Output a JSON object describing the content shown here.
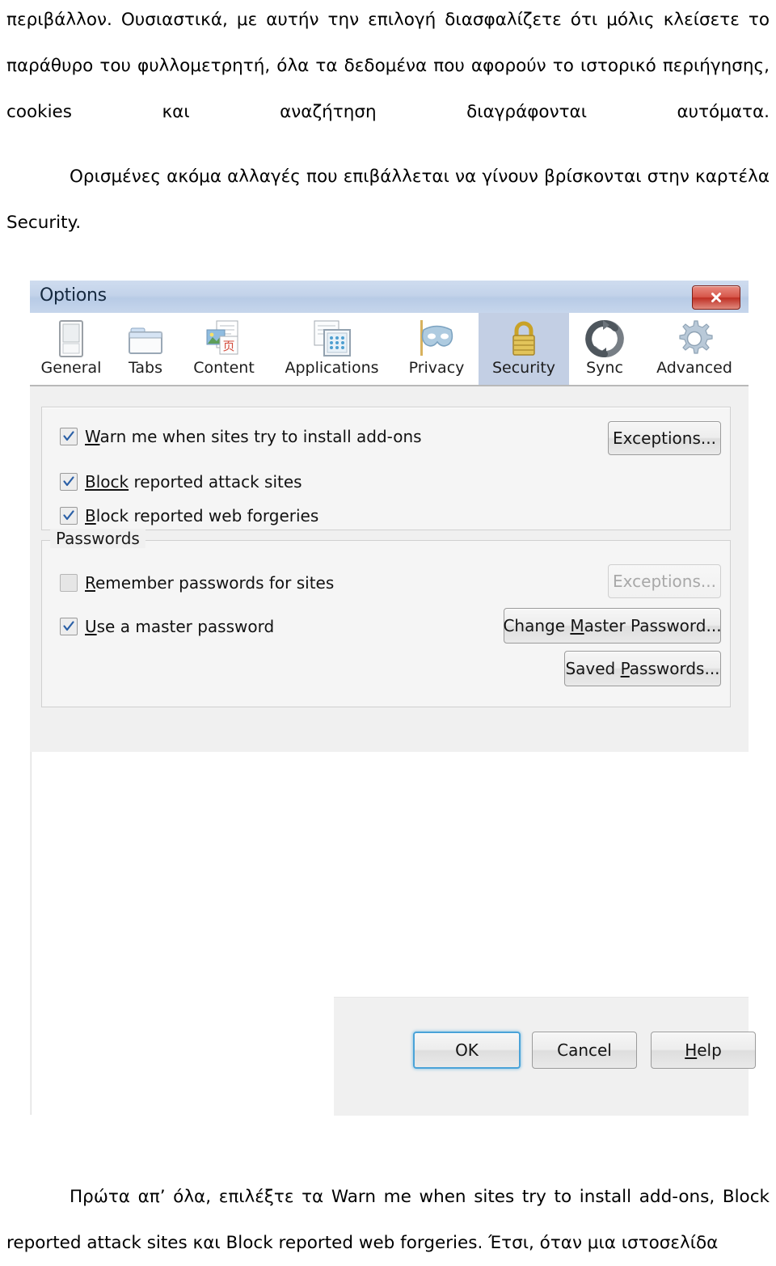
{
  "document": {
    "paragraph_top": "περιβάλλον. Ουσιαστικά, με αυτήν την επιλογή διασφαλίζετε ότι μόλις κλείσετε το παράθυρο του φυλλομετρητή, όλα τα δεδομένα που αφορούν το ιστορικό περιήγησης, cookies και αναζήτηση διαγράφονται αυτόματα.",
    "paragraph_middle": "Ορισμένες ακόμα αλλαγές που επιβάλλεται να γίνουν βρίσκονται στην καρτέλα Security.",
    "paragraph_bottom": "Πρώτα απ’ όλα, επιλέξτε τα Warn me when sites try to install add-ons, Block reported attack sites και Block reported web forgeries. Έτσι, όταν μια ιστοσελίδα"
  },
  "dialog": {
    "title": "Options",
    "close_icon": "close-icon",
    "tabs": [
      {
        "label": "General",
        "icon": "window-icon",
        "selected": false
      },
      {
        "label": "Tabs",
        "icon": "folder-tabs-icon",
        "selected": false
      },
      {
        "label": "Content",
        "icon": "content-page-icon",
        "selected": false
      },
      {
        "label": "Applications",
        "icon": "applications-icon",
        "selected": false
      },
      {
        "label": "Privacy",
        "icon": "mask-icon",
        "selected": false
      },
      {
        "label": "Security",
        "icon": "padlock-icon",
        "selected": true
      },
      {
        "label": "Sync",
        "icon": "sync-arrows-icon",
        "selected": false
      },
      {
        "label": "Advanced",
        "icon": "gear-icon",
        "selected": false
      }
    ],
    "security": {
      "warnings_group": {
        "checkboxes": [
          {
            "label_prefix": "W",
            "label_rest": "arn me when sites try to install add-ons",
            "checked": true
          },
          {
            "label_prefix": "Block",
            "label_rest": " reported attack sites",
            "checked": true
          },
          {
            "label_prefix": "B",
            "label_rest": "lock reported web forgeries",
            "checked": true
          }
        ],
        "exceptions_button": "Exceptions...",
        "exceptions_button_enabled": true
      },
      "passwords_group": {
        "title": "Passwords",
        "checkboxes": [
          {
            "label_prefix": "R",
            "label_rest": "emember passwords for sites",
            "checked": false
          },
          {
            "label_prefix": "U",
            "label_rest": "se a master password",
            "checked": true
          }
        ],
        "exceptions_button": "Exceptions...",
        "exceptions_button_enabled": false,
        "change_master_prefix": "Change ",
        "change_master_key": "M",
        "change_master_rest": "aster Password...",
        "saved_passwords_prefix": "Saved ",
        "saved_passwords_key": "P",
        "saved_passwords_rest": "asswords..."
      }
    },
    "footer": {
      "ok": "OK",
      "cancel": "Cancel",
      "help_key": "H",
      "help_rest": "elp"
    },
    "colors": {
      "titlebar": "#c3d3ea",
      "selected_tab": "#c3cfe4",
      "close_button": "#bf2f24",
      "default_button_focus": "#4aa3d8",
      "checkmark": "#2a5fa6"
    }
  }
}
